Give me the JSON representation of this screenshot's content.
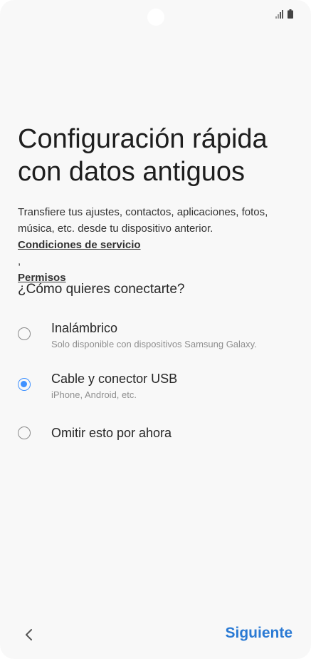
{
  "status_bar": {
    "signal_icon": "signal-bars-icon",
    "battery_icon": "battery-icon"
  },
  "title": {
    "line1": "Configuración rápida",
    "line2": "con datos antiguos"
  },
  "description": {
    "line1": "Transfiere tus ajustes, contactos, aplicaciones, fotos,",
    "line2": "música, etc. desde tu dispositivo anterior.",
    "link_terms": "Condiciones de servicio",
    "link_separator": ",",
    "link_permissions": "Permisos"
  },
  "question": "¿Cómo quieres conectarte?",
  "options": [
    {
      "label": "Inalámbrico",
      "sublabel": "Solo disponible con dispositivos Samsung Galaxy.",
      "selected": false
    },
    {
      "label": "Cable y conector USB",
      "sublabel": "iPhone, Android, etc.",
      "selected": true
    },
    {
      "label": "Omitir esto por ahora",
      "sublabel": "",
      "selected": false
    }
  ],
  "footer": {
    "back_icon": "chevron-left-icon",
    "next_label": "Siguiente"
  },
  "colors": {
    "accent": "#3e91ff",
    "next_button": "#2a7ad4",
    "background": "#f8f8f8"
  }
}
